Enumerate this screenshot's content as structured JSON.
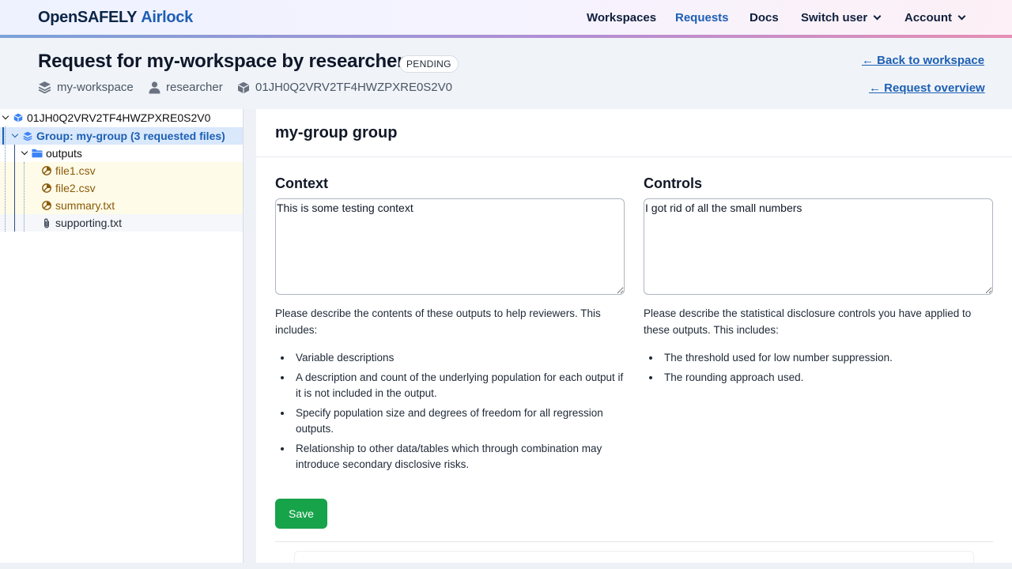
{
  "app": {
    "logo_part1": "OpenSAFELY",
    "logo_part2": "Airlock"
  },
  "nav": {
    "workspaces": "Workspaces",
    "requests": "Requests",
    "docs": "Docs",
    "switch_user": "Switch user",
    "account": "Account"
  },
  "request": {
    "title": "Request for my-workspace by researcher",
    "status": "PENDING",
    "workspace": "my-workspace",
    "author": "researcher",
    "id": "01JH0Q2VRV2TF4HWZPXRE0S2V0",
    "back_link": "← Back to workspace",
    "overview_link": "← Request overview"
  },
  "tree": {
    "root": "01JH0Q2VRV2TF4HWZPXRE0S2V0",
    "group": "Group: my-group (3 requested files)",
    "folder": "outputs",
    "files": [
      "file1.csv",
      "file2.csv",
      "summary.txt"
    ],
    "supporting": "supporting.txt"
  },
  "group": {
    "title": "my-group group",
    "context_label": "Context",
    "context_value": "This is some testing context",
    "context_help": "Please describe the contents of these outputs to help reviewers. This includes:",
    "context_bullets": [
      "Variable descriptions",
      "A description and count of the underlying population for each output if it is not included in the output.",
      "Specify population size and degrees of freedom for all regression outputs.",
      "Relationship to other data/tables which through combination may introduce secondary disclosive risks."
    ],
    "controls_label": "Controls",
    "controls_value": "I got rid of all the small numbers",
    "controls_help": "Please describe the statistical disclosure controls you have applied to these outputs. This includes:",
    "controls_bullets": [
      "The threshold used for low number suppression.",
      "The rounding approach used."
    ],
    "save_label": "Save"
  },
  "colors": {
    "accent": "#1d5fb4",
    "save": "#17a34a",
    "requested_file": "#8a5a08"
  }
}
